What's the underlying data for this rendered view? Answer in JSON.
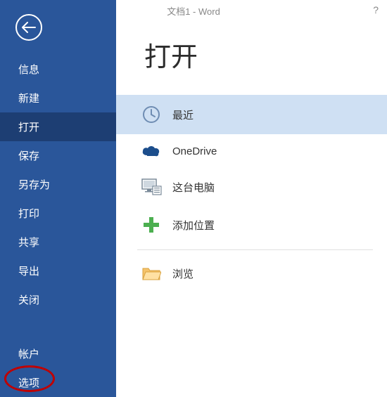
{
  "titlebar": {
    "title": "文档1 - Word",
    "help": "?"
  },
  "sidebar": {
    "items": [
      {
        "label": "信息"
      },
      {
        "label": "新建"
      },
      {
        "label": "打开"
      },
      {
        "label": "保存"
      },
      {
        "label": "另存为"
      },
      {
        "label": "打印"
      },
      {
        "label": "共享"
      },
      {
        "label": "导出"
      },
      {
        "label": "关闭"
      }
    ],
    "account_label": "帐户",
    "options_label": "选项"
  },
  "main": {
    "heading": "打开",
    "locations": [
      {
        "label": "最近"
      },
      {
        "label": "OneDrive"
      },
      {
        "label": "这台电脑"
      },
      {
        "label": "添加位置"
      },
      {
        "label": "浏览"
      }
    ]
  },
  "colors": {
    "sidebar_bg": "#2a569a",
    "sidebar_selected": "#1d3e73",
    "location_selected": "#cfe0f3",
    "annotation": "#c00000"
  }
}
